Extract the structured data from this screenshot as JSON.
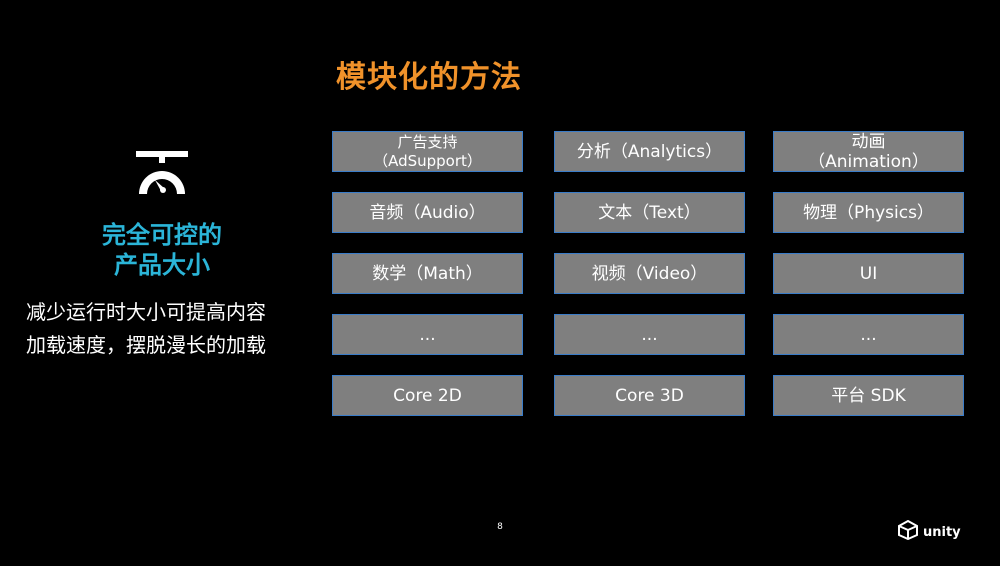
{
  "slide": {
    "title": "模块化的方法",
    "title_color": "#f0922a",
    "accent_color": "#2bb5d8",
    "box_fill": "#7f7f7f",
    "box_border": "#3a7cc8",
    "headline_lines": [
      "完全可控的",
      "产品大小"
    ],
    "description_lines": [
      "减少运行时大小可提高内容",
      "加载速度，摆脱漫长的加载"
    ],
    "modules": [
      [
        "广告支持\n（AdSupport）",
        "分析（Analytics）",
        "动画\n（Animation）"
      ],
      [
        "音频（Audio）",
        "文本（Text）",
        "物理（Physics）"
      ],
      [
        "数学（Math）",
        "视频（Video）",
        "UI"
      ],
      [
        "...",
        "...",
        "..."
      ],
      [
        "Core 2D",
        "Core 3D",
        "平台 SDK"
      ]
    ],
    "page_number": "8",
    "logo_text": "unity",
    "icons": {
      "headline_icon": "control-gauge-icon",
      "logo_icon": "unity-cube-icon"
    }
  }
}
